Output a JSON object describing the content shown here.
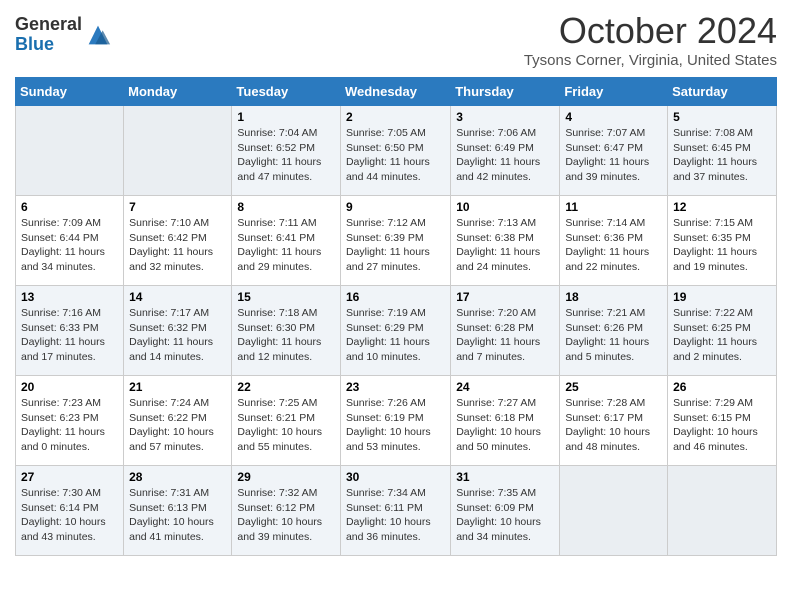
{
  "header": {
    "logo_line1": "General",
    "logo_line2": "Blue",
    "month": "October 2024",
    "location": "Tysons Corner, Virginia, United States"
  },
  "days_of_week": [
    "Sunday",
    "Monday",
    "Tuesday",
    "Wednesday",
    "Thursday",
    "Friday",
    "Saturday"
  ],
  "weeks": [
    [
      {
        "num": "",
        "info": ""
      },
      {
        "num": "",
        "info": ""
      },
      {
        "num": "1",
        "info": "Sunrise: 7:04 AM\nSunset: 6:52 PM\nDaylight: 11 hours and 47 minutes."
      },
      {
        "num": "2",
        "info": "Sunrise: 7:05 AM\nSunset: 6:50 PM\nDaylight: 11 hours and 44 minutes."
      },
      {
        "num": "3",
        "info": "Sunrise: 7:06 AM\nSunset: 6:49 PM\nDaylight: 11 hours and 42 minutes."
      },
      {
        "num": "4",
        "info": "Sunrise: 7:07 AM\nSunset: 6:47 PM\nDaylight: 11 hours and 39 minutes."
      },
      {
        "num": "5",
        "info": "Sunrise: 7:08 AM\nSunset: 6:45 PM\nDaylight: 11 hours and 37 minutes."
      }
    ],
    [
      {
        "num": "6",
        "info": "Sunrise: 7:09 AM\nSunset: 6:44 PM\nDaylight: 11 hours and 34 minutes."
      },
      {
        "num": "7",
        "info": "Sunrise: 7:10 AM\nSunset: 6:42 PM\nDaylight: 11 hours and 32 minutes."
      },
      {
        "num": "8",
        "info": "Sunrise: 7:11 AM\nSunset: 6:41 PM\nDaylight: 11 hours and 29 minutes."
      },
      {
        "num": "9",
        "info": "Sunrise: 7:12 AM\nSunset: 6:39 PM\nDaylight: 11 hours and 27 minutes."
      },
      {
        "num": "10",
        "info": "Sunrise: 7:13 AM\nSunset: 6:38 PM\nDaylight: 11 hours and 24 minutes."
      },
      {
        "num": "11",
        "info": "Sunrise: 7:14 AM\nSunset: 6:36 PM\nDaylight: 11 hours and 22 minutes."
      },
      {
        "num": "12",
        "info": "Sunrise: 7:15 AM\nSunset: 6:35 PM\nDaylight: 11 hours and 19 minutes."
      }
    ],
    [
      {
        "num": "13",
        "info": "Sunrise: 7:16 AM\nSunset: 6:33 PM\nDaylight: 11 hours and 17 minutes."
      },
      {
        "num": "14",
        "info": "Sunrise: 7:17 AM\nSunset: 6:32 PM\nDaylight: 11 hours and 14 minutes."
      },
      {
        "num": "15",
        "info": "Sunrise: 7:18 AM\nSunset: 6:30 PM\nDaylight: 11 hours and 12 minutes."
      },
      {
        "num": "16",
        "info": "Sunrise: 7:19 AM\nSunset: 6:29 PM\nDaylight: 11 hours and 10 minutes."
      },
      {
        "num": "17",
        "info": "Sunrise: 7:20 AM\nSunset: 6:28 PM\nDaylight: 11 hours and 7 minutes."
      },
      {
        "num": "18",
        "info": "Sunrise: 7:21 AM\nSunset: 6:26 PM\nDaylight: 11 hours and 5 minutes."
      },
      {
        "num": "19",
        "info": "Sunrise: 7:22 AM\nSunset: 6:25 PM\nDaylight: 11 hours and 2 minutes."
      }
    ],
    [
      {
        "num": "20",
        "info": "Sunrise: 7:23 AM\nSunset: 6:23 PM\nDaylight: 11 hours and 0 minutes."
      },
      {
        "num": "21",
        "info": "Sunrise: 7:24 AM\nSunset: 6:22 PM\nDaylight: 10 hours and 57 minutes."
      },
      {
        "num": "22",
        "info": "Sunrise: 7:25 AM\nSunset: 6:21 PM\nDaylight: 10 hours and 55 minutes."
      },
      {
        "num": "23",
        "info": "Sunrise: 7:26 AM\nSunset: 6:19 PM\nDaylight: 10 hours and 53 minutes."
      },
      {
        "num": "24",
        "info": "Sunrise: 7:27 AM\nSunset: 6:18 PM\nDaylight: 10 hours and 50 minutes."
      },
      {
        "num": "25",
        "info": "Sunrise: 7:28 AM\nSunset: 6:17 PM\nDaylight: 10 hours and 48 minutes."
      },
      {
        "num": "26",
        "info": "Sunrise: 7:29 AM\nSunset: 6:15 PM\nDaylight: 10 hours and 46 minutes."
      }
    ],
    [
      {
        "num": "27",
        "info": "Sunrise: 7:30 AM\nSunset: 6:14 PM\nDaylight: 10 hours and 43 minutes."
      },
      {
        "num": "28",
        "info": "Sunrise: 7:31 AM\nSunset: 6:13 PM\nDaylight: 10 hours and 41 minutes."
      },
      {
        "num": "29",
        "info": "Sunrise: 7:32 AM\nSunset: 6:12 PM\nDaylight: 10 hours and 39 minutes."
      },
      {
        "num": "30",
        "info": "Sunrise: 7:34 AM\nSunset: 6:11 PM\nDaylight: 10 hours and 36 minutes."
      },
      {
        "num": "31",
        "info": "Sunrise: 7:35 AM\nSunset: 6:09 PM\nDaylight: 10 hours and 34 minutes."
      },
      {
        "num": "",
        "info": ""
      },
      {
        "num": "",
        "info": ""
      }
    ]
  ]
}
